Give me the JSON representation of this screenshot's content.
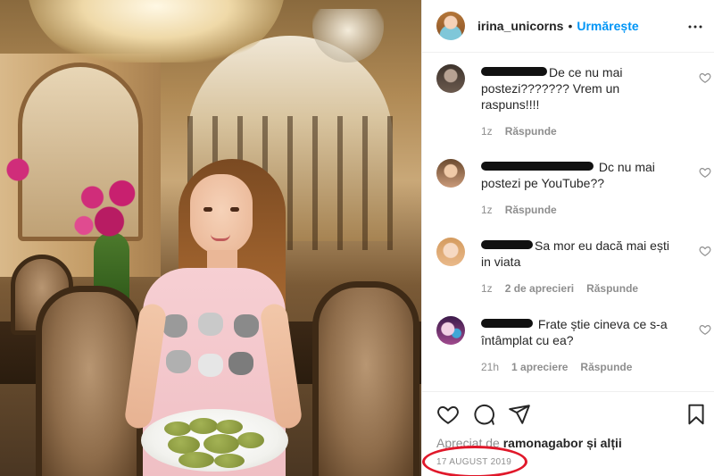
{
  "header": {
    "username": "irina_unicorns",
    "separator": "•",
    "follow_label": "Urmărește",
    "more_icon": "more-options-icon"
  },
  "comments": [
    {
      "text": "De ce nu mai postezi??????? Vrem un raspuns!!!!",
      "time": "1z",
      "likes": "",
      "reply": "Răspunde",
      "avatar_color": "#6b5a4e"
    },
    {
      "text": " Dc nu mai postezi pe YouTube??",
      "time": "1z",
      "likes": "",
      "reply": "Răspunde",
      "avatar_color": "#c99a7a"
    },
    {
      "text": "Sa mor eu dacă mai ești in viata",
      "time": "1z",
      "likes": "2 de aprecieri",
      "reply": "Răspunde",
      "avatar_color": "#e9b98a"
    },
    {
      "text": " Frate știe cineva ce s-a întâmplat cu ea?",
      "time": "21h",
      "likes": "1 apreciere",
      "reply": "Răspunde",
      "avatar_color": "#6a2e6e"
    }
  ],
  "actions": {
    "like_icon": "heart-icon",
    "comment_icon": "comment-icon",
    "share_icon": "share-icon",
    "save_icon": "bookmark-icon"
  },
  "likes_line": {
    "prefix": "Apreciat de",
    "user": "ramonagabor",
    "suffix": "și alții"
  },
  "date": "17 AUGUST 2019",
  "colors": {
    "accent": "#0095f6",
    "text": "#262626",
    "muted": "#8e8e8e",
    "annotation": "#e0182a"
  }
}
